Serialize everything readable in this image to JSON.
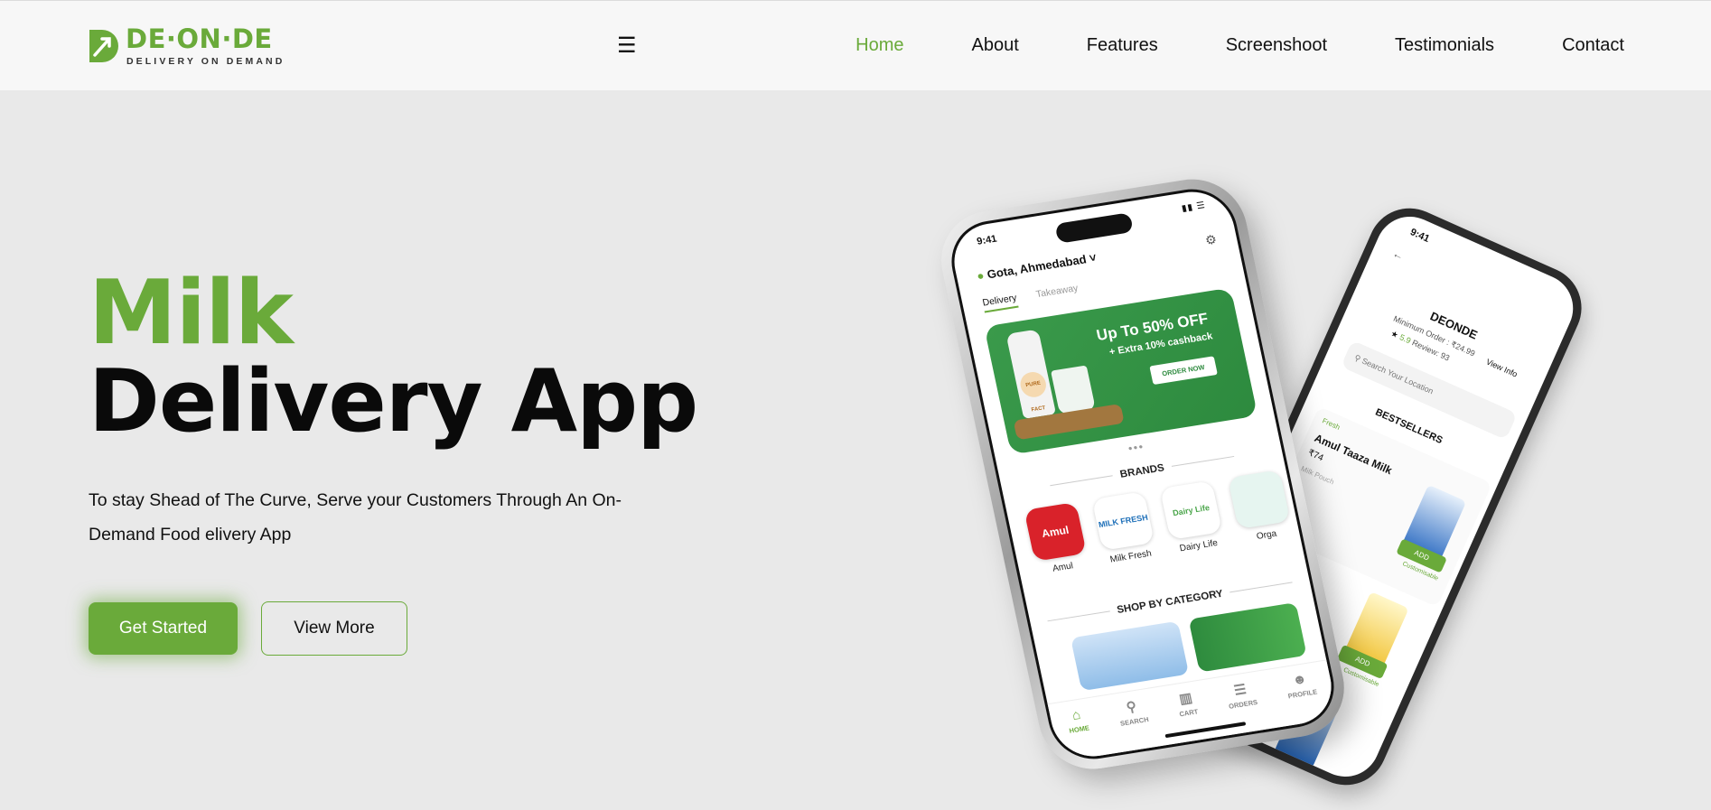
{
  "brand": {
    "title": "DE·ON·DE",
    "subtitle": "DELIVERY ON DEMAND",
    "accent_color": "#6aaa3a"
  },
  "nav": {
    "menu_icon": "hamburger-icon",
    "items": [
      {
        "label": "Home",
        "active": true
      },
      {
        "label": "About",
        "active": false
      },
      {
        "label": "Features",
        "active": false
      },
      {
        "label": "Screenshoot",
        "active": false
      },
      {
        "label": "Testimonials",
        "active": false
      },
      {
        "label": "Contact",
        "active": false
      }
    ]
  },
  "hero": {
    "title_highlight": "Milk",
    "title_main": "Delivery App",
    "description": "To stay Shead of The Curve, Serve your Customers Through An On-Demand Food elivery App",
    "primary_button": "Get Started",
    "secondary_button": "View More"
  },
  "phone_front": {
    "time": "9:41",
    "location": "Gota, Ahmedabad",
    "tabs": [
      "Delivery",
      "Takeaway"
    ],
    "banner": {
      "offer": "Up To 50% OFF",
      "cashback": "+ Extra 10% cashback",
      "button": "ORDER NOW",
      "bottle_label": "PURE FACT"
    },
    "brands_title": "BRANDS",
    "brands": [
      {
        "name": "Amul",
        "logo_text": "Amul",
        "color": "#d9222a"
      },
      {
        "name": "Milk Fresh",
        "logo_text": "MILK FRESH",
        "color": "#1d6fb8"
      },
      {
        "name": "Dairy Life",
        "logo_text": "Dairy Life",
        "color": "#4aa54a"
      },
      {
        "name": "Orga",
        "logo_text": "",
        "color": "#9fd6c8"
      }
    ],
    "category_title": "SHOP BY CATEGORY",
    "bottom_nav": [
      "HOME",
      "SEARCH",
      "CART",
      "ORDERS",
      "PROFILE"
    ]
  },
  "phone_back": {
    "time": "9:41",
    "store": "DEONDE",
    "min_order": "Minimum Order : ₹24.99",
    "rating": "5.9",
    "reviews": "Review: 93",
    "view_info": "View Info",
    "search_placeholder": "Search Your Location",
    "bestsellers": "BESTSELLERS",
    "item_tag": "Fresh",
    "item_name": "Amul Taaza Milk",
    "item_price": "₹74",
    "item_sub": "Milk Pouch",
    "add_label": "ADD",
    "customisable": "Customisable"
  }
}
